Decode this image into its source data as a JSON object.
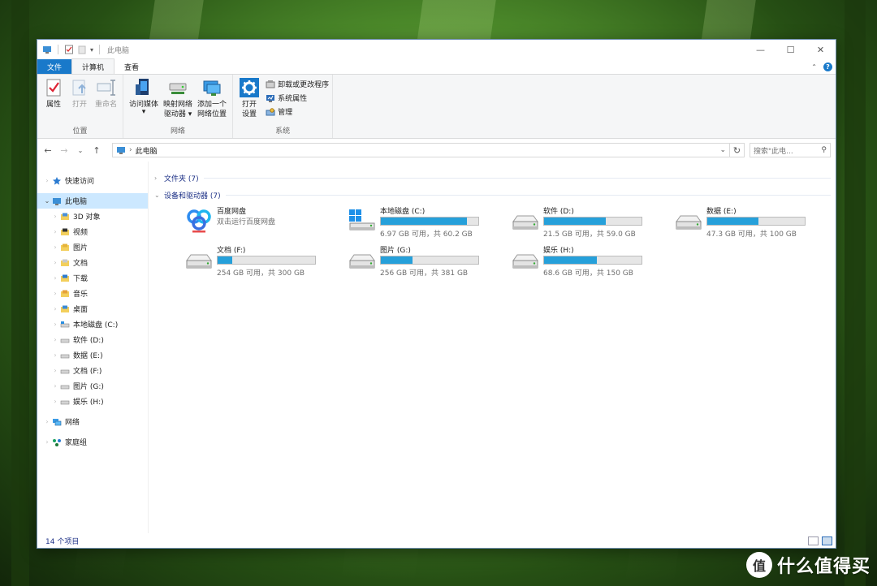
{
  "window": {
    "title": "此电脑",
    "controls": {
      "minimize": "—",
      "maximize": "☐",
      "close": "✕"
    }
  },
  "ribbon": {
    "tabs": [
      {
        "label": "文件"
      },
      {
        "label": "计算机"
      },
      {
        "label": "查看"
      }
    ],
    "groups": {
      "location": {
        "label": "位置",
        "buttons": [
          {
            "label": "属性"
          },
          {
            "label": "打开"
          },
          {
            "label": "重命名"
          }
        ]
      },
      "network": {
        "label": "网络",
        "buttons": [
          {
            "label": "访问媒体",
            "dropdown": "▾"
          },
          {
            "label_line1": "映射网络",
            "label_line2": "驱动器 ▾"
          },
          {
            "label_line1": "添加一个",
            "label_line2": "网络位置"
          }
        ]
      },
      "system": {
        "label": "系统",
        "open_settings_line1": "打开",
        "open_settings_line2": "设置",
        "small": [
          {
            "label": "卸载或更改程序"
          },
          {
            "label": "系统属性"
          },
          {
            "label": "管理"
          }
        ]
      }
    }
  },
  "navbar": {
    "back": "←",
    "forward": "→",
    "recent": "⌄",
    "up": "↑",
    "breadcrumb_sep": "›",
    "breadcrumb": "此电脑",
    "search_placeholder": "搜索\"此电..."
  },
  "sidebar": {
    "quick_access": "快速访问",
    "this_pc": "此电脑",
    "children": [
      {
        "label": "3D 对象"
      },
      {
        "label": "视频"
      },
      {
        "label": "图片"
      },
      {
        "label": "文档"
      },
      {
        "label": "下载"
      },
      {
        "label": "音乐"
      },
      {
        "label": "桌面"
      },
      {
        "label": "本地磁盘 (C:)"
      },
      {
        "label": "软件 (D:)"
      },
      {
        "label": "数据 (E:)"
      },
      {
        "label": "文档 (F:)"
      },
      {
        "label": "图片 (G:)"
      },
      {
        "label": "娱乐 (H:)"
      }
    ],
    "network": "网络",
    "homegroup": "家庭组"
  },
  "main": {
    "folders_header": "文件夹 (7)",
    "devices_header": "设备和驱动器 (7)",
    "baidu": {
      "name": "百度网盘",
      "sub": "双击运行百度网盘"
    },
    "drives": [
      {
        "name": "本地磁盘 (C:)",
        "sub": "6.97 GB 可用，共 60.2 GB",
        "used_fraction": 0.884
      },
      {
        "name": "软件 (D:)",
        "sub": "21.5 GB 可用，共 59.0 GB",
        "used_fraction": 0.636
      },
      {
        "name": "数据 (E:)",
        "sub": "47.3 GB 可用，共 100 GB",
        "used_fraction": 0.527
      },
      {
        "name": "文档 (F:)",
        "sub": "254 GB 可用，共 300 GB",
        "used_fraction": 0.153
      },
      {
        "name": "图片 (G:)",
        "sub": "256 GB 可用，共 381 GB",
        "used_fraction": 0.328
      },
      {
        "name": "娱乐 (H:)",
        "sub": "68.6 GB 可用，共 150 GB",
        "used_fraction": 0.543
      }
    ]
  },
  "statusbar": {
    "item_count": "14 个项目"
  },
  "watermark": {
    "logo": "值",
    "text": "什么值得买"
  },
  "colors": {
    "accent": "#1979ca",
    "bar_fill": "#26a0da",
    "selected": "#cce8ff"
  }
}
